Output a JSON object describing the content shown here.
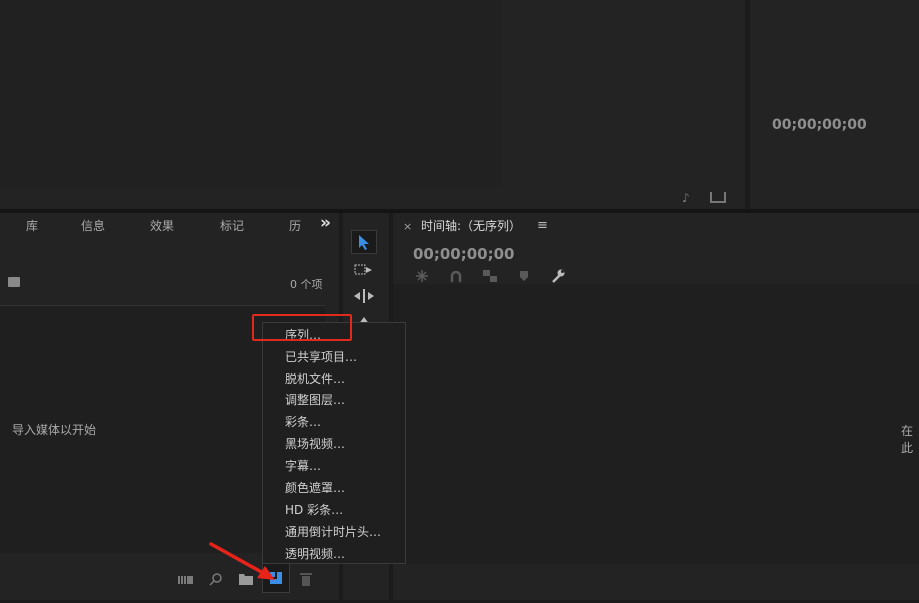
{
  "program_monitor": {
    "timecode": "00;00;00;00"
  },
  "project_panel": {
    "tabs": [
      "库",
      "信息",
      "效果",
      "标记",
      "历"
    ],
    "overflow_label": "»",
    "item_count": "0 个项",
    "empty_hint": "导入媒体以开始"
  },
  "timeline_panel": {
    "close_label": "×",
    "title": "时间轴:（无序列）",
    "menu_label": "≡",
    "timecode": "00;00;00;00",
    "right_hint": "在此"
  },
  "context_menu": {
    "items": [
      "序列…",
      "已共享项目…",
      "脱机文件…",
      "调整图层…",
      "彩条…",
      "黑场视频…",
      "字幕…",
      "颜色遮罩…",
      "HD 彩条…",
      "通用倒计时片头…",
      "透明视频…"
    ]
  },
  "colors": {
    "accent_blue": "#3a8ee6",
    "highlight_red": "#e02a1e",
    "arrow_red": "#e8241a"
  },
  "icons": [
    "arrow-select-icon",
    "track-select-icon",
    "ripple-edit-icon",
    "razor-icon",
    "search-icon",
    "bin-icon",
    "new-item-icon",
    "trash-icon",
    "list-view-icon",
    "snap-icon",
    "linked-icon",
    "marker-icon",
    "wrench-icon",
    "export-icon",
    "music-icon"
  ]
}
